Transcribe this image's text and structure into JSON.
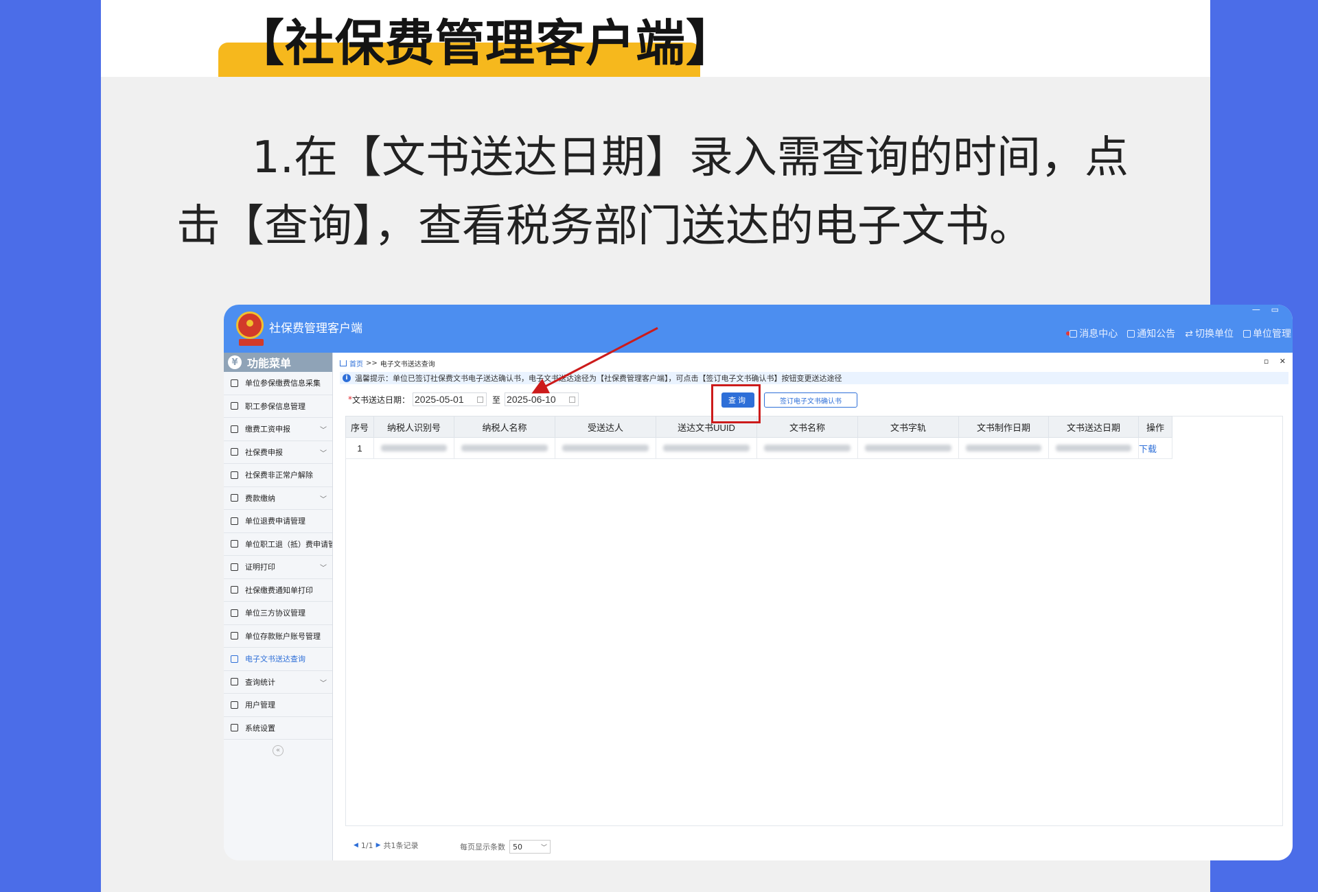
{
  "poster": {
    "title": "【社保费管理客户端】",
    "instruction": "1.在【文书送达日期】录入需查询的时间，点击【查询】，查看税务部门送达的电子文书。"
  },
  "app": {
    "title": "社保费管理客户端",
    "window_controls": "— ▭",
    "header_nav": [
      "消息中心",
      "通知公告",
      "切换单位",
      "单位管理"
    ]
  },
  "sidebar": {
    "header": "功能菜单",
    "items": [
      {
        "label": "单位参保缴费信息采集",
        "icon": "list-icon",
        "expandable": false
      },
      {
        "label": "职工参保信息管理",
        "icon": "list-icon",
        "expandable": false
      },
      {
        "label": "缴费工资申报",
        "icon": "edit-icon",
        "expandable": true
      },
      {
        "label": "社保费申报",
        "icon": "list-icon",
        "expandable": true
      },
      {
        "label": "社保费非正常户解除",
        "icon": "list-icon",
        "expandable": false
      },
      {
        "label": "费款缴纳",
        "icon": "card-icon",
        "expandable": true
      },
      {
        "label": "单位退费申请管理",
        "icon": "list-icon",
        "expandable": false
      },
      {
        "label": "单位职工退（抵）费申请管理",
        "icon": "list-icon",
        "expandable": false
      },
      {
        "label": "证明打印",
        "icon": "doc-icon",
        "expandable": true
      },
      {
        "label": "社保缴费通知单打印",
        "icon": "printer-icon",
        "expandable": false
      },
      {
        "label": "单位三方协议管理",
        "icon": "card-icon",
        "expandable": false
      },
      {
        "label": "单位存款账户账号管理",
        "icon": "card-icon",
        "expandable": false
      },
      {
        "label": "电子文书送达查询",
        "icon": "printer-icon",
        "expandable": false,
        "active": true
      },
      {
        "label": "查询统计",
        "icon": "chart-icon",
        "expandable": true
      },
      {
        "label": "用户管理",
        "icon": "gear-icon",
        "expandable": false
      },
      {
        "label": "系统设置",
        "icon": "gear-icon",
        "expandable": false
      }
    ]
  },
  "content": {
    "breadcrumb": {
      "home": "首页",
      "separator": ">>",
      "current": "电子文书送达查询"
    },
    "panel_controls": "▫ ✕",
    "tip": "温馨提示：单位已签订社保费文书电子送达确认书，电子文书送达途径为【社保费管理客户端】，可点击【签订电子文书确认书】按钮变更送达途径",
    "query": {
      "required_mark": "*",
      "date_label": "文书送达日期：",
      "start_date": "2025-05-01",
      "to_label": "至",
      "end_date": "2025-06-10",
      "query_button": "查询",
      "sign_button": "签订电子文书确认书"
    },
    "table": {
      "columns": [
        "序号",
        "纳税人识别号",
        "纳税人名称",
        "受送达人",
        "送达文书UUID",
        "文书名称",
        "文书字轨",
        "文书制作日期",
        "文书送达日期",
        "操作"
      ],
      "rows": [
        {
          "index": "1",
          "action": "下载"
        }
      ]
    },
    "pager": {
      "page_info": "1/1",
      "total": "共1条记录",
      "page_size_label": "每页显示条数",
      "page_size": "50"
    }
  },
  "colors": {
    "background": "#4b6de8",
    "header": "#4c8ef0",
    "accent": "#2e6fd8",
    "highlight": "#cc1b1b",
    "title_bar": "#f6b81d"
  }
}
